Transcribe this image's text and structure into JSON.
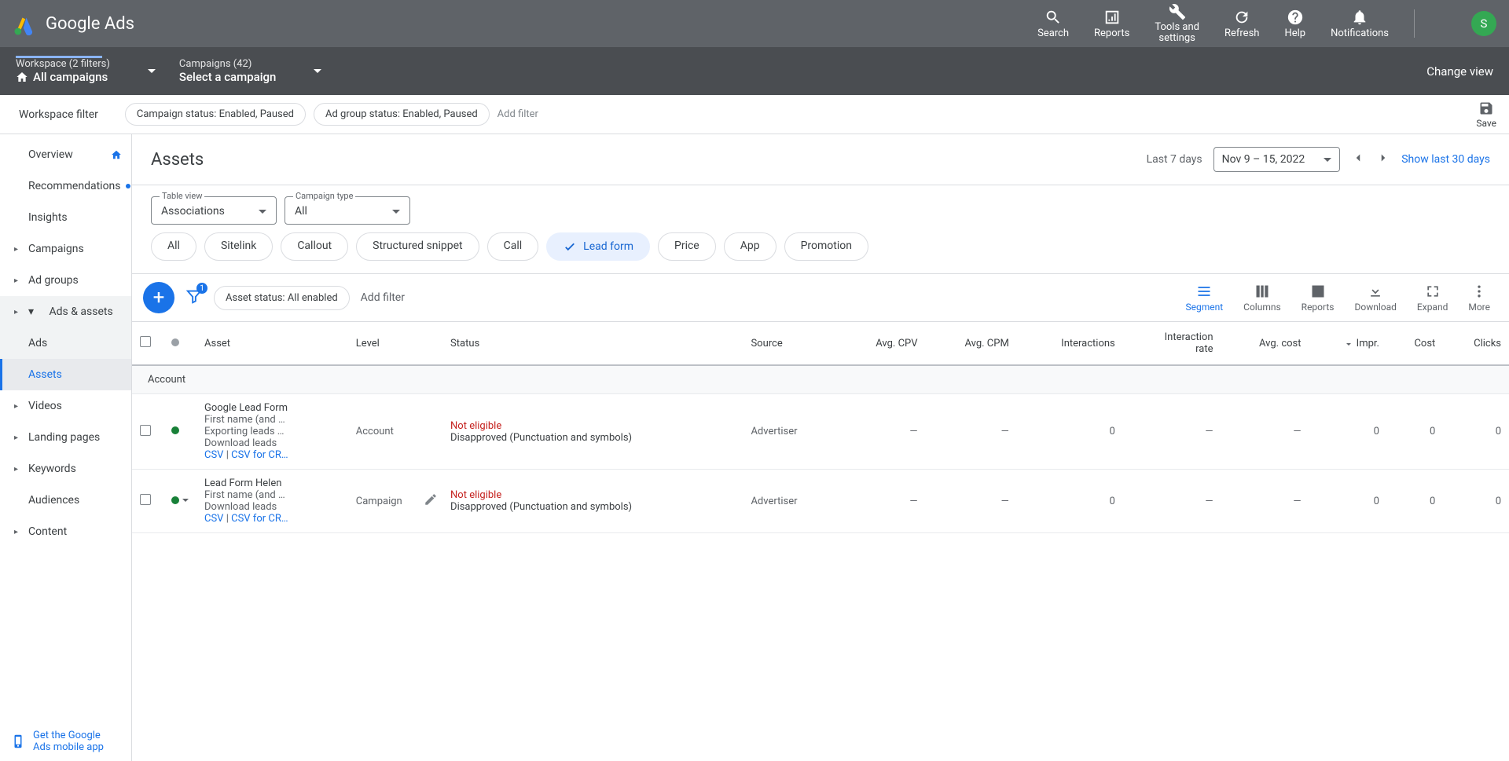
{
  "header": {
    "product": "Google Ads",
    "tools": {
      "search": "Search",
      "reports": "Reports",
      "tools_settings_l1": "Tools and",
      "tools_settings_l2": "settings",
      "refresh": "Refresh",
      "help": "Help",
      "notifications": "Notifications"
    },
    "avatar": "S"
  },
  "breadcrumb": {
    "workspace_top": "Workspace (2 filters)",
    "workspace_main": "All campaigns",
    "campaigns_top": "Campaigns (42)",
    "campaigns_main": "Select a campaign",
    "change_view": "Change view"
  },
  "wfilter": {
    "label": "Workspace filter",
    "chip1": "Campaign status: Enabled, Paused",
    "chip2": "Ad group status: Enabled, Paused",
    "add": "Add filter",
    "save": "Save"
  },
  "sidebar": {
    "overview": "Overview",
    "recommendations": "Recommendations",
    "insights": "Insights",
    "campaigns": "Campaigns",
    "adgroups": "Ad groups",
    "ads_assets": "Ads & assets",
    "ads": "Ads",
    "assets": "Assets",
    "videos": "Videos",
    "landing": "Landing pages",
    "keywords": "Keywords",
    "audiences": "Audiences",
    "content": "Content",
    "footer_l1": "Get the Google",
    "footer_l2": "Ads mobile app"
  },
  "page": {
    "title": "Assets",
    "last7": "Last 7 days",
    "date_range": "Nov 9 – 15, 2022",
    "show30": "Show last 30 days"
  },
  "selectors": {
    "tv_label": "Table view",
    "tv_value": "Associations",
    "ct_label": "Campaign type",
    "ct_value": "All"
  },
  "types": [
    "All",
    "Sitelink",
    "Callout",
    "Structured snippet",
    "Call",
    "Lead form",
    "Price",
    "App",
    "Promotion"
  ],
  "types_active_idx": 5,
  "toolbar": {
    "funnel_badge": "1",
    "chip": "Asset status: All enabled",
    "add": "Add filter",
    "segment": "Segment",
    "columns": "Columns",
    "reports": "Reports",
    "download": "Download",
    "expand": "Expand",
    "more": "More"
  },
  "columns": [
    "Asset",
    "Level",
    "Status",
    "Source",
    "Avg. CPV",
    "Avg. CPM",
    "Interactions",
    "Interaction rate",
    "Avg. cost",
    "Impr.",
    "Cost",
    "Clicks"
  ],
  "group_label": "Account",
  "rows": [
    {
      "title": "Google Lead Form",
      "sub1": "First name (and …",
      "sub2": "Exporting leads …",
      "dl_label": "Download leads",
      "csv": "CSV",
      "csv_crm": "CSV for CR…",
      "level": "Account",
      "status_top": "Not eligible",
      "status_detail": "Disapproved (Punctuation and symbols)",
      "source": "Advertiser",
      "cpv": "—",
      "cpm": "—",
      "interactions": "0",
      "rate": "—",
      "avgcost": "—",
      "impr": "0",
      "cost": "0",
      "clicks": "0",
      "editable": false
    },
    {
      "title": "Lead Form Helen",
      "sub1": "First name (and …",
      "sub2": "",
      "dl_label": "Download leads",
      "csv": "CSV",
      "csv_crm": "CSV for CR…",
      "level": "Campaign",
      "status_top": "Not eligible",
      "status_detail": "Disapproved (Punctuation and symbols)",
      "source": "Advertiser",
      "cpv": "—",
      "cpm": "—",
      "interactions": "0",
      "rate": "—",
      "avgcost": "—",
      "impr": "0",
      "cost": "0",
      "clicks": "0",
      "editable": true
    }
  ]
}
